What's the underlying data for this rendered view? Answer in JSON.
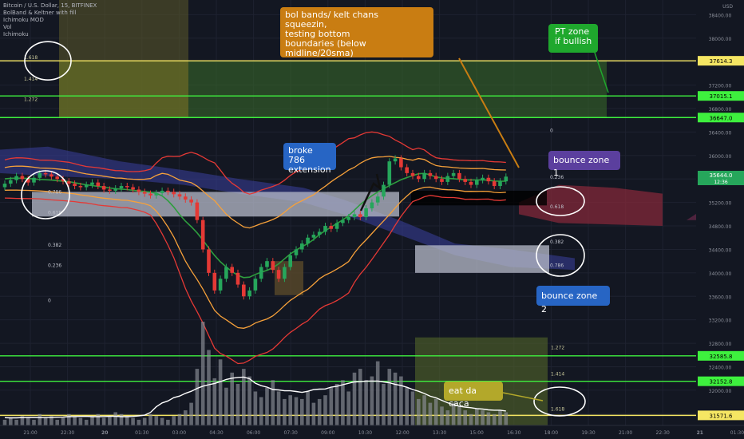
{
  "header": {
    "symbol_line": "Bitcoin / U.S. Dollar, 15, BITFINEX",
    "indicators": [
      "BolBand & Keltner with fill",
      "Ichimoku MOD",
      "Vol",
      "Ichimoku"
    ]
  },
  "currency": "USD",
  "colors": {
    "background": "#131722",
    "up_candle": "#26a65b",
    "down_candle": "#e53935",
    "yellow_level": "#f5e663",
    "green_level": "#3ef03e",
    "orange_band": "#f7a13a",
    "red_band": "#e53935",
    "callout_orange": "#c97d12",
    "callout_blue": "#2765c4",
    "callout_purple": "#5b3f9e",
    "callout_green": "#1fa82d",
    "callout_yellow": "#b3a82a"
  },
  "annotations": {
    "bol_bands": [
      "bol bands/ kelt chans",
      "squeezin,",
      "testing bottom",
      "boundaries (below midline/20sma)"
    ],
    "pt_zone": [
      "PT zone",
      "if bullish"
    ],
    "broke_786": [
      "broke 786",
      "extension"
    ],
    "bounce_zone_1": "bounce zone 1",
    "bounce_zone_2": "bounce zone 2",
    "eat_da_caca": "eat da caca"
  },
  "chart_data": {
    "type": "candlestick",
    "title": "Bitcoin / U.S. Dollar, 15, BITFINEX",
    "ylabel": "USD",
    "ylim": [
      31400,
      38650
    ],
    "y_ticks": [
      31600,
      32000,
      32400,
      32800,
      33200,
      33600,
      34000,
      34400,
      34800,
      35200,
      35600,
      36000,
      36400,
      36800,
      37200,
      37600,
      38000,
      38400
    ],
    "x_ticks": [
      "21:00",
      "22:30",
      "20",
      "01:30",
      "03:00",
      "04:30",
      "06:00",
      "07:30",
      "09:00",
      "10:30",
      "12:00",
      "13:30",
      "15:00",
      "16:30",
      "18:00",
      "19:30",
      "21:00",
      "22:30",
      "21",
      "01:30"
    ],
    "level_lines": [
      {
        "price": 37614.3,
        "label": "37614.3",
        "color": "yellow"
      },
      {
        "price": 37015.1,
        "label": "37015.1",
        "color": "green"
      },
      {
        "price": 36647.0,
        "label": "36647.0",
        "color": "green"
      },
      {
        "price": 32585.8,
        "label": "32585.8",
        "color": "green"
      },
      {
        "price": 32152.8,
        "label": "32152.8",
        "color": "green"
      },
      {
        "price": 31571.6,
        "label": "31571.6",
        "color": "yellow"
      }
    ],
    "current_price": {
      "value": 35644.0,
      "label": "35644.0",
      "countdown": "12:36"
    },
    "fib_labels_upper": [
      "1.618",
      "1.414",
      "1.272"
    ],
    "fib_labels_left": [
      "0.786",
      "0.618",
      "0.382",
      "0.236",
      "0"
    ],
    "fib_labels_right": [
      "0",
      "0.236",
      "0.382",
      "0.618",
      "0.786"
    ],
    "fib_labels_lower": [
      "1.272",
      "1.414",
      "1.618"
    ],
    "candles_close": [
      35520,
      35580,
      35650,
      35600,
      35540,
      35620,
      35700,
      35680,
      35640,
      35600,
      35560,
      35520,
      35480,
      35460,
      35500,
      35540,
      35480,
      35420,
      35400,
      35440,
      35480,
      35460,
      35420,
      35380,
      35350,
      35320,
      35360,
      35400,
      35380,
      35340,
      35300,
      35250,
      35200,
      34900,
      34400,
      34000,
      33700,
      33900,
      34100,
      34000,
      33800,
      33600,
      33700,
      33900,
      34100,
      34200,
      34050,
      33900,
      34100,
      34300,
      34400,
      34500,
      34600,
      34650,
      34700,
      34800,
      34750,
      34850,
      34900,
      34950,
      35000,
      34950,
      35100,
      35200,
      35300,
      35500,
      35900,
      35950,
      35800,
      35700,
      35650,
      35600,
      35700,
      35650,
      35600,
      35550,
      35650,
      35700,
      35600,
      35550,
      35500,
      35580,
      35620,
      35560,
      35480,
      35560,
      35640
    ],
    "candles_open": [
      35460,
      35520,
      35580,
      35650,
      35600,
      35540,
      35620,
      35700,
      35680,
      35640,
      35600,
      35560,
      35520,
      35480,
      35460,
      35500,
      35540,
      35480,
      35420,
      35400,
      35440,
      35480,
      35460,
      35420,
      35380,
      35350,
      35320,
      35360,
      35400,
      35380,
      35340,
      35300,
      35250,
      35200,
      34900,
      34400,
      34000,
      33700,
      33900,
      34100,
      34000,
      33800,
      33600,
      33700,
      33900,
      34100,
      34200,
      34050,
      33900,
      34100,
      34300,
      34400,
      34500,
      34600,
      34650,
      34700,
      34800,
      34750,
      34850,
      34900,
      34950,
      35000,
      34950,
      35100,
      35200,
      35300,
      35500,
      35900,
      35950,
      35800,
      35700,
      35650,
      35600,
      35700,
      35650,
      35600,
      35550,
      35650,
      35700,
      35600,
      35550,
      35500,
      35580,
      35620,
      35560,
      35480,
      35560
    ],
    "volume": [
      3,
      4,
      3,
      5,
      4,
      3,
      6,
      4,
      5,
      3,
      4,
      6,
      5,
      4,
      3,
      5,
      6,
      4,
      5,
      7,
      6,
      5,
      4,
      3,
      4,
      6,
      5,
      4,
      3,
      5,
      6,
      8,
      12,
      30,
      55,
      40,
      25,
      35,
      20,
      28,
      22,
      30,
      26,
      18,
      15,
      20,
      24,
      18,
      14,
      16,
      15,
      14,
      18,
      12,
      14,
      16,
      20,
      22,
      24,
      18,
      28,
      30,
      24,
      26,
      34,
      22,
      30,
      28,
      26,
      20,
      18,
      14,
      16,
      12,
      14,
      10,
      8,
      12,
      10,
      8,
      6,
      9,
      8,
      7,
      6,
      8,
      7
    ]
  }
}
